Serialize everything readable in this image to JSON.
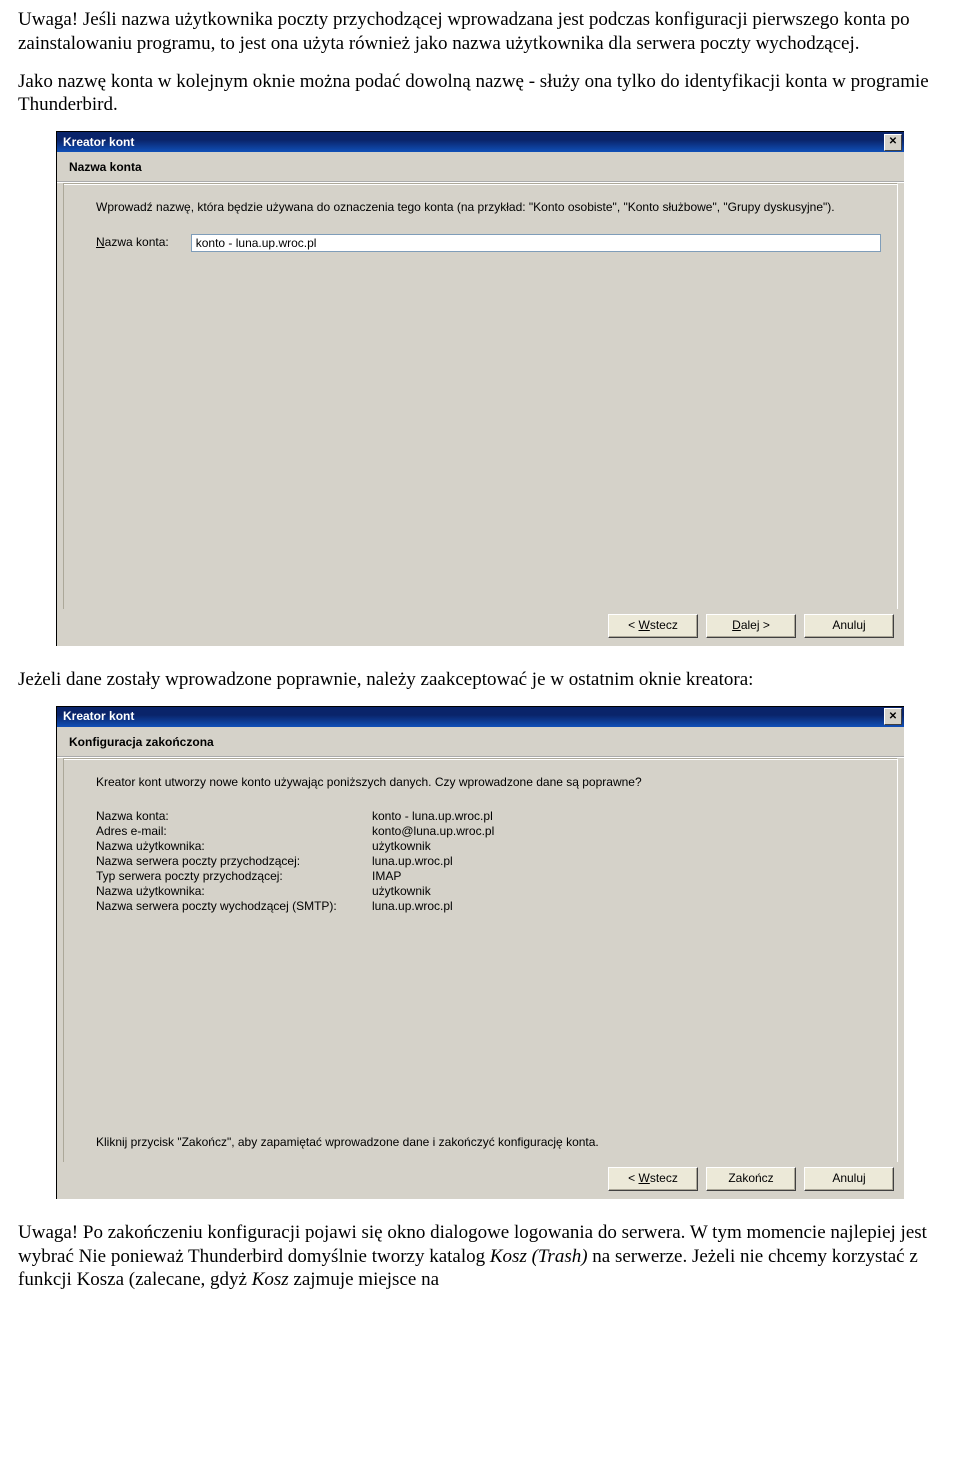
{
  "intro": {
    "p1_prefix": "Uwaga!",
    "p1_rest": " Jeśli nazwa użytkownika poczty przychodzącej wprowadzana jest podczas konfiguracji pierwszego konta po zainstalowaniu programu, to jest ona użyta również jako nazwa użytkownika dla serwera poczty wychodzącej.",
    "p2": "Jako nazwę konta w kolejnym oknie można podać dowolną nazwę - służy ona tylko do identyfikacji konta w programie Thunderbird."
  },
  "dialog1": {
    "title": "Kreator kont",
    "header": "Nazwa konta",
    "instruction": "Wprowadź nazwę, która będzie używana do oznaczenia tego konta (na przykład: \"Konto osobiste\", \"Konto służbowe\", \"Grupy dyskusyjne\").",
    "field_label_pre": "N",
    "field_label_post": "azwa konta:",
    "field_value": "konto - luna.up.wroc.pl",
    "back_pre": "< ",
    "back_u": "W",
    "back_post": "stecz",
    "next_u": "D",
    "next_post": "alej >",
    "cancel": "Anuluj"
  },
  "mid_paragraph": "Jeżeli dane zostały wprowadzone poprawnie, należy zaakceptować je w ostatnim oknie kreatora:",
  "dialog2": {
    "title": "Kreator kont",
    "header": "Konfiguracja zakończona",
    "instruction": "Kreator kont utworzy nowe konto używając poniższych danych. Czy wprowadzone dane są poprawne?",
    "rows": [
      {
        "label": "Nazwa konta:",
        "value": "konto - luna.up.wroc.pl"
      },
      {
        "label": "Adres e-mail:",
        "value": "konto@luna.up.wroc.pl"
      },
      {
        "label": "Nazwa użytkownika:",
        "value": "użytkownik"
      },
      {
        "label": "Nazwa serwera poczty przychodzącej:",
        "value": "luna.up.wroc.pl"
      },
      {
        "label": "Typ serwera poczty przychodzącej:",
        "value": "IMAP"
      },
      {
        "label": "Nazwa użytkownika:",
        "value": "użytkownik"
      },
      {
        "label": "Nazwa serwera poczty wychodzącej (SMTP):",
        "value": "luna.up.wroc.pl"
      }
    ],
    "footer_note": "Kliknij przycisk \"Zakończ\", aby zapamiętać wprowadzone dane i zakończyć konfigurację konta.",
    "back_pre": "< ",
    "back_u": "W",
    "back_post": "stecz",
    "finish": "Zakończ",
    "cancel": "Anuluj"
  },
  "outro": {
    "prefix": "Uwaga!",
    "text1": " Po zakończeniu konfiguracji pojawi się okno dialogowe logowania do serwera. W tym momencie najlepiej jest wybrać Nie ponieważ Thunderbird domyślnie tworzy katalog ",
    "italic1": "Kosz (Trash)",
    "text2": " na serwerze. Jeżeli nie chcemy korzystać z funkcji Kosza (zalecane, gdyż ",
    "italic2": "Kosz",
    "text3": " zajmuje miejsce na"
  }
}
